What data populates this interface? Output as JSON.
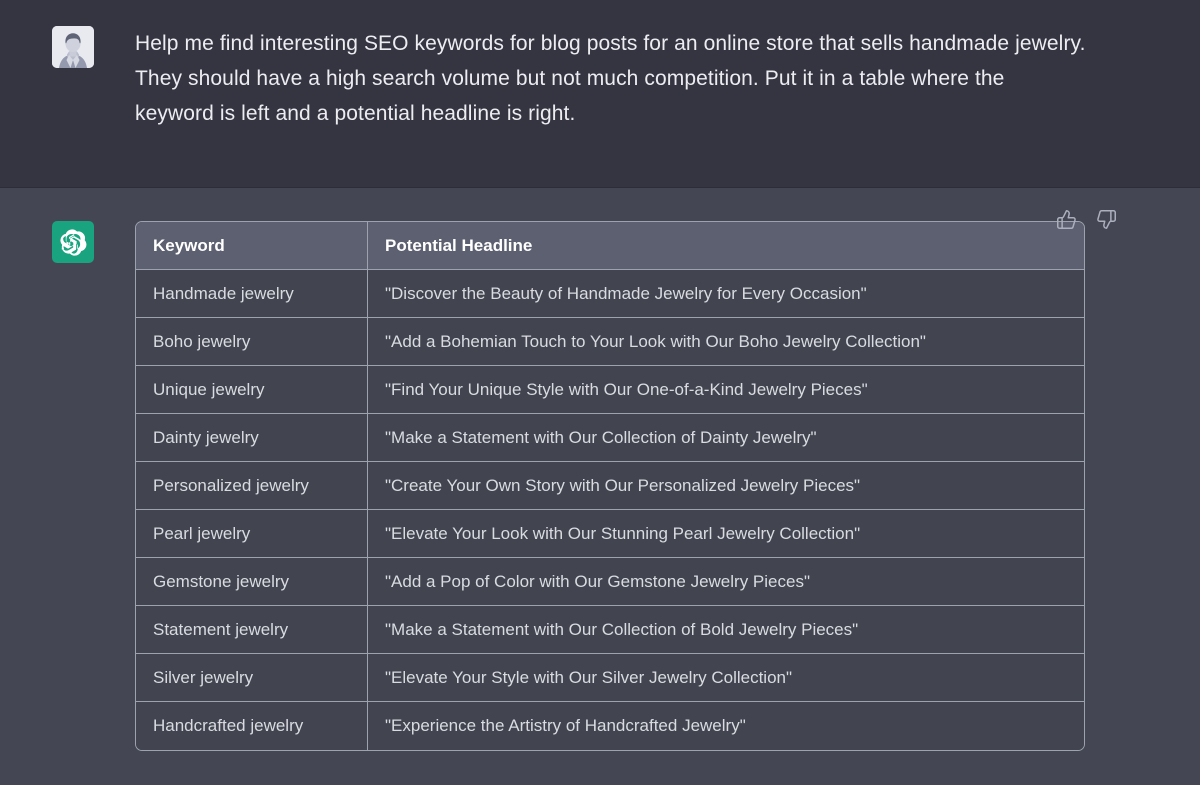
{
  "conversation": {
    "user_message": {
      "avatar_alt": "user-avatar-photo",
      "text": "Help me find interesting SEO keywords for blog posts for an online store that sells handmade jewelry. They should have a high search volume but not much competition. Put it in a table where the keyword is left and a potential headline is right."
    },
    "assistant_message": {
      "avatar_icon": "openai-logo-icon",
      "avatar_background": "#19a37f",
      "table": {
        "headers": [
          "Keyword",
          "Potential Headline"
        ],
        "rows": [
          [
            "Handmade jewelry",
            "\"Discover the Beauty of Handmade Jewelry for Every Occasion\""
          ],
          [
            "Boho jewelry",
            "\"Add a Bohemian Touch to Your Look with Our Boho Jewelry Collection\""
          ],
          [
            "Unique jewelry",
            "\"Find Your Unique Style with Our One-of-a-Kind Jewelry Pieces\""
          ],
          [
            "Dainty jewelry",
            "\"Make a Statement with Our Collection of Dainty Jewelry\""
          ],
          [
            "Personalized jewelry",
            "\"Create Your Own Story with Our Personalized Jewelry Pieces\""
          ],
          [
            "Pearl jewelry",
            "\"Elevate Your Look with Our Stunning Pearl Jewelry Collection\""
          ],
          [
            "Gemstone jewelry",
            "\"Add a Pop of Color with Our Gemstone Jewelry Pieces\""
          ],
          [
            "Statement jewelry",
            "\"Make a Statement with Our Collection of Bold Jewelry Pieces\""
          ],
          [
            "Silver jewelry",
            "\"Elevate Your Style with Our Silver Jewelry Collection\""
          ],
          [
            "Handcrafted jewelry",
            "\"Experience the Artistry of Handcrafted Jewelry\""
          ]
        ]
      },
      "feedback": {
        "thumbs_up_icon": "thumbs-up-icon",
        "thumbs_down_icon": "thumbs-down-icon"
      }
    }
  },
  "theme": {
    "user_turn_background": "#343541",
    "assistant_turn_background": "#444654",
    "table_header_background": "#5c6070",
    "table_cell_background": "#42444f",
    "table_border": "#9ca3af",
    "body_text": "#d9dbe1",
    "header_text": "#ffffff",
    "accent_green": "#19a37f",
    "icon_muted": "#acafbd"
  }
}
